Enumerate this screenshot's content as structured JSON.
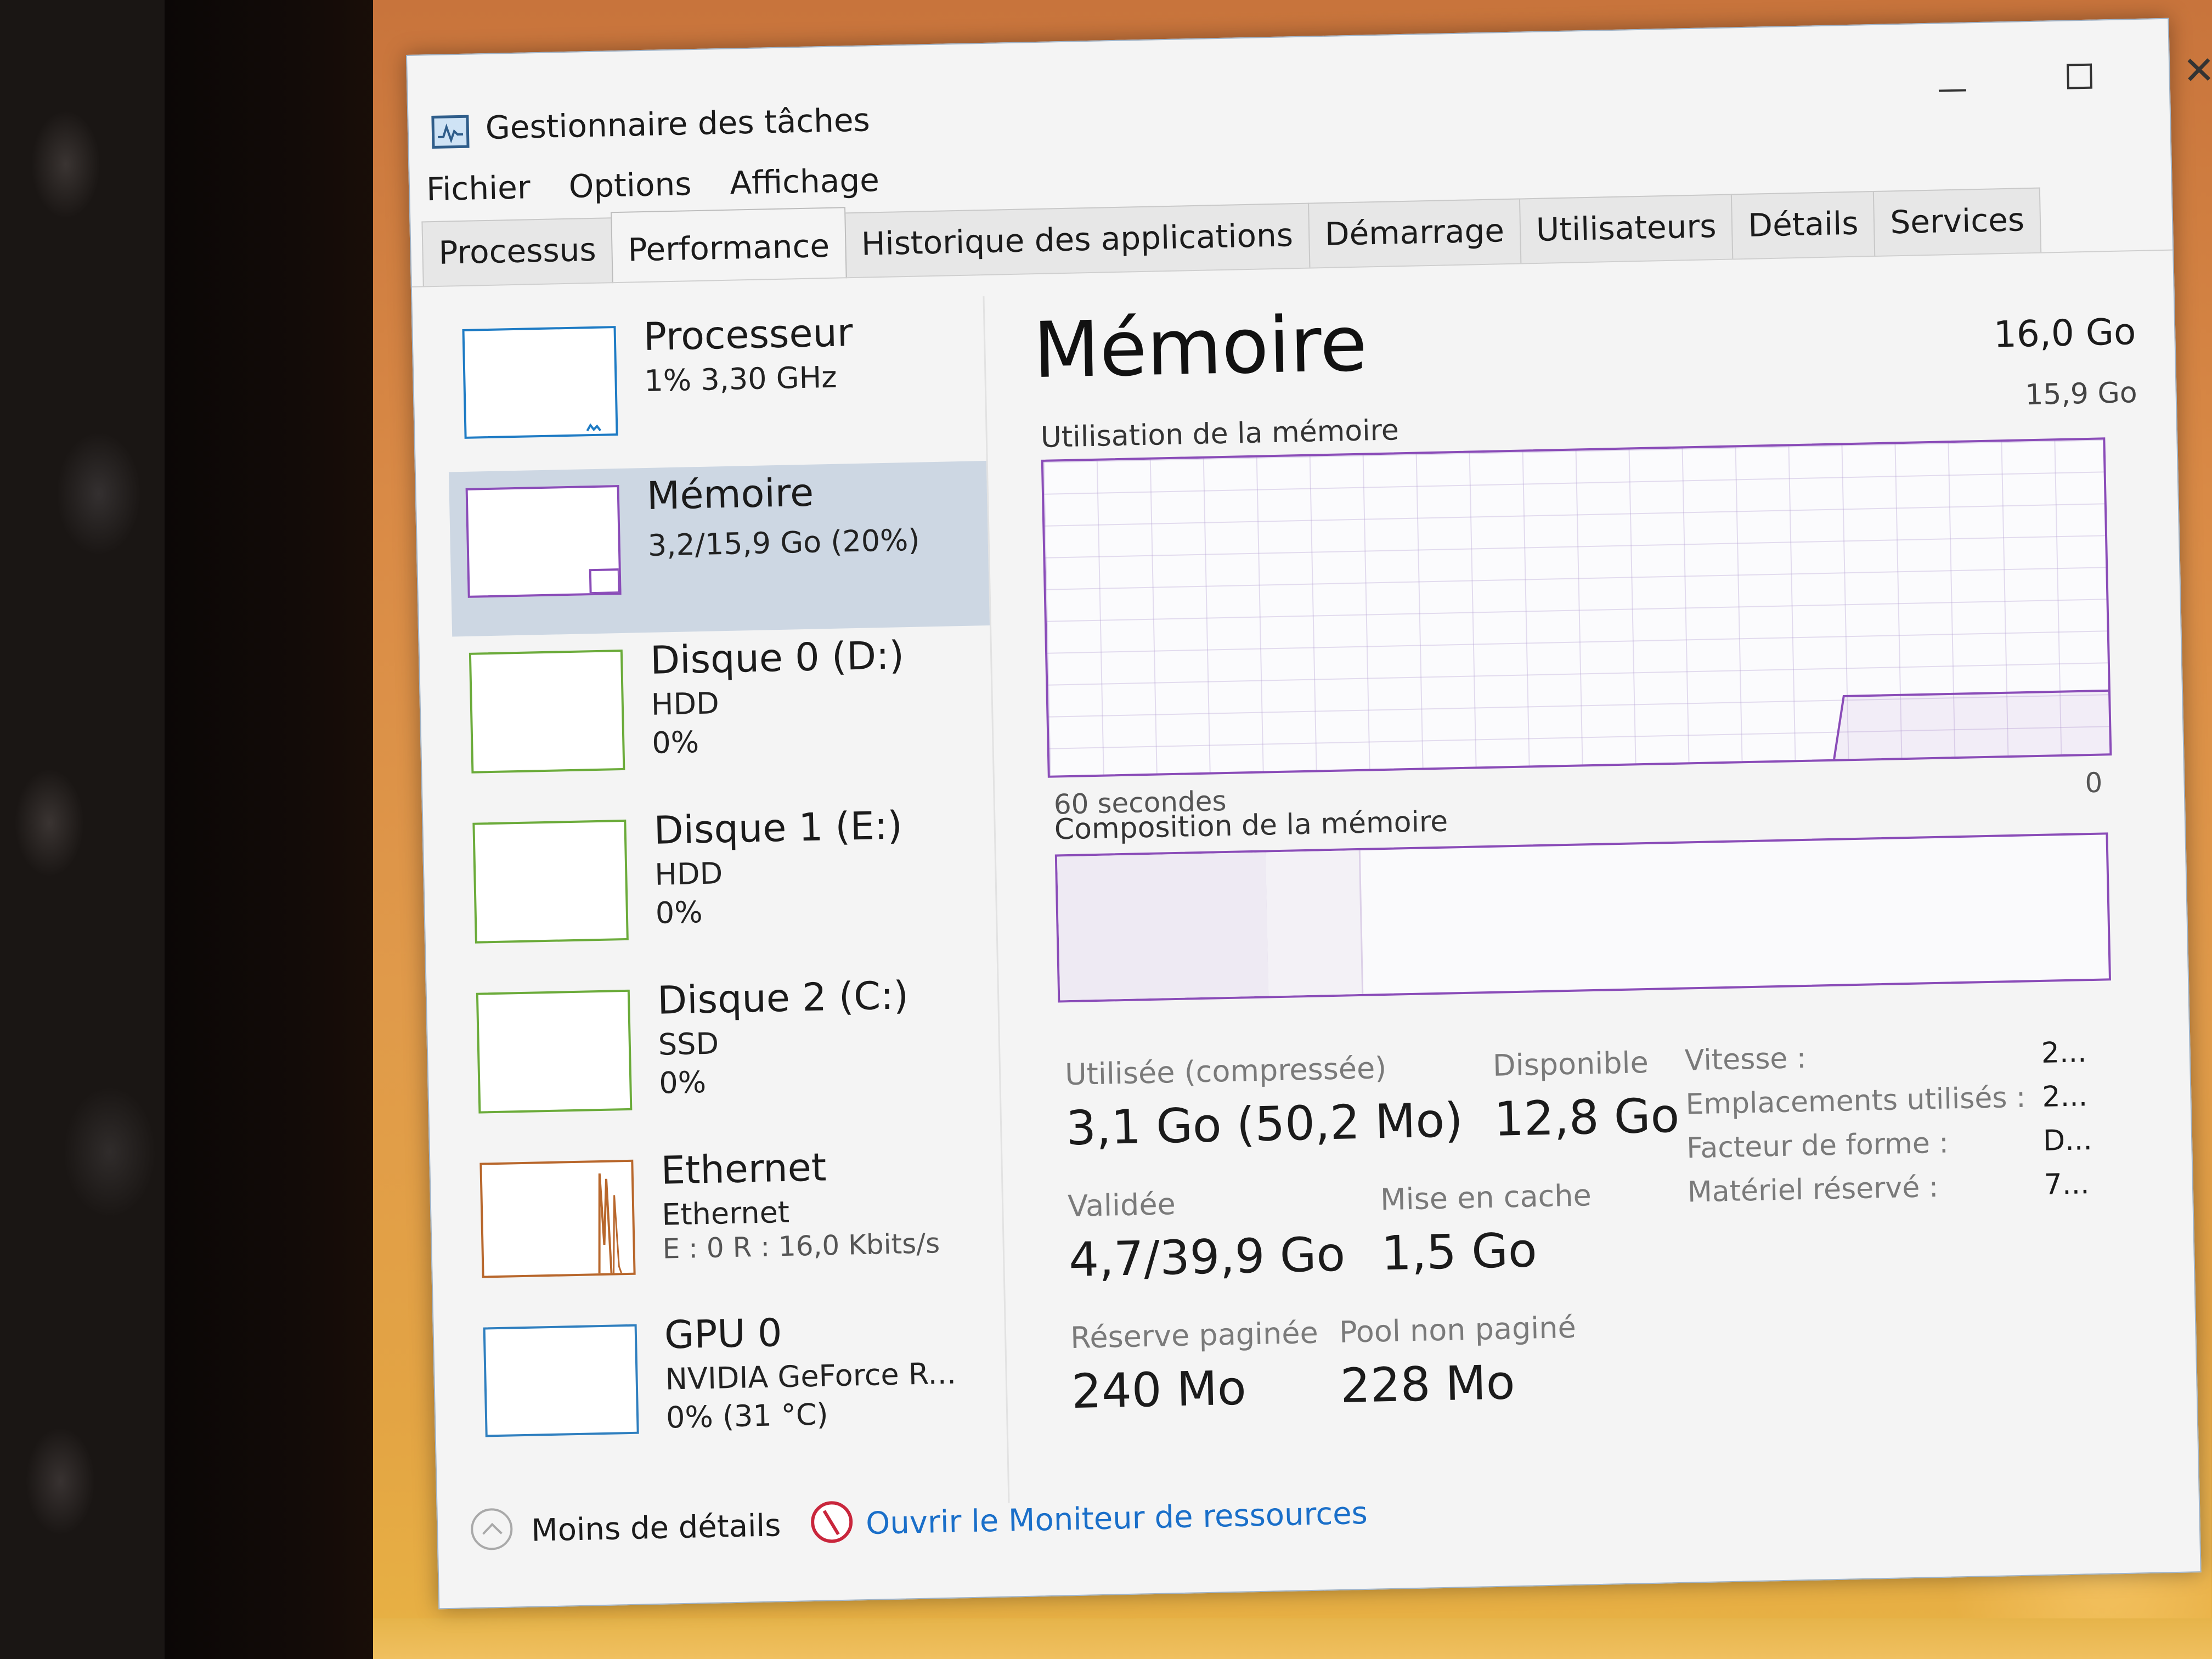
{
  "window": {
    "title": "Gestionnaire des tâches"
  },
  "menu": [
    "Fichier",
    "Options",
    "Affichage"
  ],
  "tabs": [
    "Processus",
    "Performance",
    "Historique des applications",
    "Démarrage",
    "Utilisateurs",
    "Détails",
    "Services"
  ],
  "sidebar": {
    "items": [
      {
        "name": "Processeur",
        "line1": "1% 3,30 GHz",
        "line2": "",
        "line3": ""
      },
      {
        "name": "Mémoire",
        "line1": "3,2/15,9 Go (20%)",
        "line2": "",
        "line3": ""
      },
      {
        "name": "Disque 0 (D:)",
        "line1": "HDD",
        "line2": "0%",
        "line3": ""
      },
      {
        "name": "Disque 1 (E:)",
        "line1": "HDD",
        "line2": "0%",
        "line3": ""
      },
      {
        "name": "Disque 2 (C:)",
        "line1": "SSD",
        "line2": "0%",
        "line3": ""
      },
      {
        "name": "Ethernet",
        "line1": "Ethernet",
        "line2": "E : 0 R : 16,0 Kbits/s",
        "line3": ""
      },
      {
        "name": "GPU 0",
        "line1": "NVIDIA GeForce R...",
        "line2": "0% (31 °C)",
        "line3": ""
      }
    ]
  },
  "memory": {
    "title": "Mémoire",
    "total": "16,0 Go",
    "max_label": "15,9 Go",
    "usage_label": "Utilisation de la mémoire",
    "time_label": "60 secondes",
    "zero_label": "0",
    "composition_label": "Composition de la mémoire",
    "used_fraction": 0.2
  },
  "stats": {
    "used_label": "Utilisée (compressée)",
    "used_value": "3,1 Go (50,2 Mo)",
    "available_label": "Disponible",
    "available_value": "12,8 Go",
    "committed_label": "Validée",
    "committed_value": "4,7/39,9 Go",
    "cached_label": "Mise en cache",
    "cached_value": "1,5 Go",
    "paged_label": "Réserve paginée",
    "paged_value": "240 Mo",
    "nonpaged_label": "Pool non paginé",
    "nonpaged_value": "228 Mo"
  },
  "details": [
    {
      "label": "Vitesse :",
      "value": "2..."
    },
    {
      "label": "Emplacements utilisés :",
      "value": "2..."
    },
    {
      "label": "Facteur de forme :",
      "value": "D..."
    },
    {
      "label": "Matériel réservé :",
      "value": "7..."
    }
  ],
  "footer": {
    "less_details": "Moins de détails",
    "open_monitor": "Ouvrir le Moniteur de ressources"
  },
  "colors": {
    "memory_accent": "#8a4cb8",
    "cpu_accent": "#1e7bc4",
    "disk_accent": "#6bab3a",
    "ethernet_accent": "#b8672c",
    "gpu_accent": "#2f7fbf",
    "link": "#1a6fc9"
  }
}
